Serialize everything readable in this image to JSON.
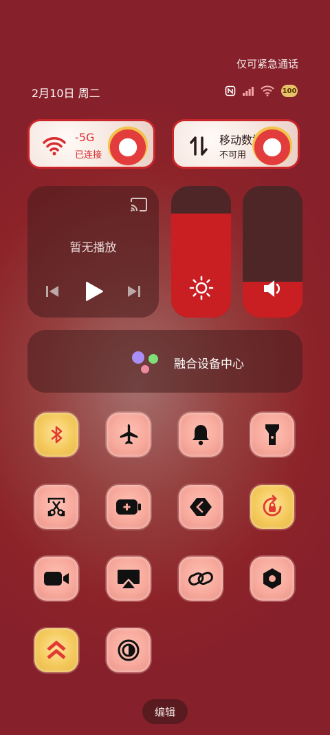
{
  "status": {
    "emergency_only": "仅可紧急通话",
    "date": "2月10日 周二",
    "battery": "100",
    "icons": [
      "nfc-icon",
      "signal-icon",
      "wifi-icon",
      "battery-icon"
    ]
  },
  "tiles": {
    "wifi": {
      "name": "-5G",
      "state": "已连接",
      "icon": "wifi-icon"
    },
    "mobile": {
      "name": "移动数据",
      "state": "不可用",
      "icon": "data-arrows-icon"
    }
  },
  "media": {
    "title": "暂无播放",
    "controls": [
      "previous-icon",
      "play-icon",
      "next-icon"
    ]
  },
  "sliders": {
    "brightness": {
      "level": 0.79,
      "icon": "sun-icon"
    },
    "volume": {
      "level": 0.27,
      "icon": "speaker-icon"
    }
  },
  "fusion_center": {
    "label": "融合设备中心"
  },
  "quick_buttons": [
    {
      "icon": "bluetooth-icon",
      "active": true
    },
    {
      "icon": "airplane-icon",
      "active": false
    },
    {
      "icon": "bell-icon",
      "active": false
    },
    {
      "icon": "flashlight-icon",
      "active": false
    },
    {
      "icon": "screenshot-scissors-icon",
      "active": false
    },
    {
      "icon": "battery-saver-icon",
      "active": false
    },
    {
      "icon": "share-icon",
      "active": false
    },
    {
      "icon": "rotation-lock-icon",
      "active": true
    },
    {
      "icon": "screen-record-icon",
      "active": false
    },
    {
      "icon": "cast-screen-icon",
      "active": false
    },
    {
      "icon": "link-icon",
      "active": false
    },
    {
      "icon": "settings-nut-icon",
      "active": false
    },
    {
      "icon": "performance-up-icon",
      "active": true
    },
    {
      "icon": "dark-mode-icon",
      "active": false
    }
  ],
  "edit_label": "编辑",
  "colors": {
    "accent_red": "#c91f23",
    "gold": "#f4c95b",
    "pink": "#f7a99c"
  }
}
